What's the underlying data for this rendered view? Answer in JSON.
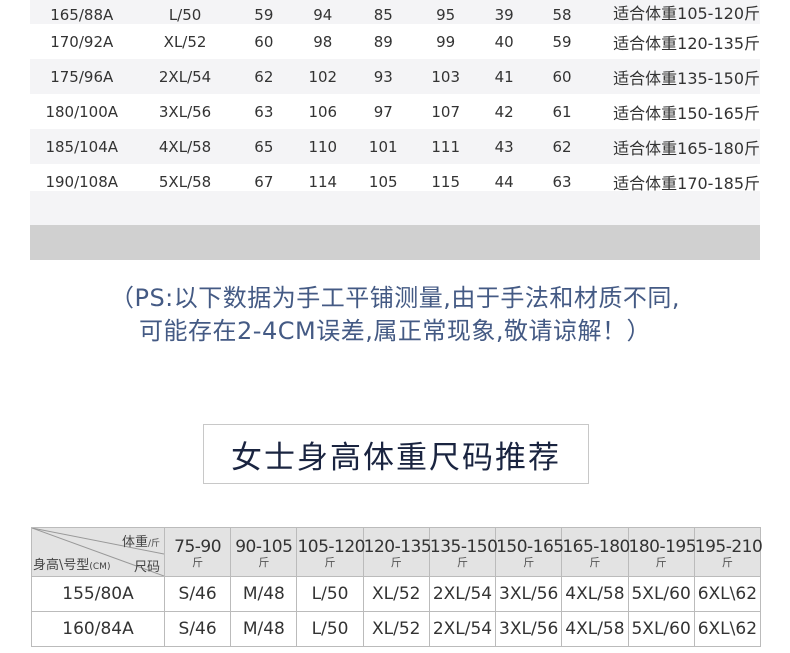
{
  "men_table": {
    "rows": [
      [
        "165/88A",
        "L/50",
        "59",
        "94",
        "85",
        "95",
        "39",
        "58",
        "适合体重105-120斤"
      ],
      [
        "170/92A",
        "XL/52",
        "60",
        "98",
        "89",
        "99",
        "40",
        "59",
        "适合体重120-135斤"
      ],
      [
        "175/96A",
        "2XL/54",
        "62",
        "102",
        "93",
        "103",
        "41",
        "60",
        "适合体重135-150斤"
      ],
      [
        "180/100A",
        "3XL/56",
        "63",
        "106",
        "97",
        "107",
        "42",
        "61",
        "适合体重150-165斤"
      ],
      [
        "185/104A",
        "4XL/58",
        "65",
        "110",
        "101",
        "111",
        "43",
        "62",
        "适合体重165-180斤"
      ],
      [
        "190/108A",
        "5XL/58",
        "67",
        "114",
        "105",
        "115",
        "44",
        "63",
        "适合体重170-185斤"
      ]
    ]
  },
  "note": {
    "line1": "（PS:以下数据为手工平铺测量,由于手法和材质不同,",
    "line2": "可能存在2-4CM误差,属正常现象,敬请谅解！）"
  },
  "women_section": {
    "title": "女士身高体重尺码推荐",
    "corner": {
      "weight": "体重",
      "weight_unit": "/斤",
      "size": "尺码",
      "height": "身高\\号型",
      "height_unit": "(CM)"
    },
    "weight_columns": [
      {
        "range": "75-90",
        "unit": "斤"
      },
      {
        "range": "90-105",
        "unit": "斤"
      },
      {
        "range": "105-120",
        "unit": "斤"
      },
      {
        "range": "120-135",
        "unit": "斤"
      },
      {
        "range": "135-150",
        "unit": "斤"
      },
      {
        "range": "150-165",
        "unit": "斤"
      },
      {
        "range": "165-180",
        "unit": "斤"
      },
      {
        "range": "180-195",
        "unit": "斤"
      },
      {
        "range": "195-210",
        "unit": "斤"
      }
    ],
    "rows": [
      {
        "height": "155/80A",
        "sizes": [
          "S/46",
          "M/48",
          "L/50",
          "XL/52",
          "2XL/54",
          "3XL/56",
          "4XL/58",
          "5XL/60",
          "6XL\\62"
        ]
      },
      {
        "height": "160/84A",
        "sizes": [
          "S/46",
          "M/48",
          "L/50",
          "XL/52",
          "2XL/54",
          "3XL/56",
          "4XL/58",
          "5XL/60",
          "6XL\\62"
        ]
      }
    ]
  }
}
